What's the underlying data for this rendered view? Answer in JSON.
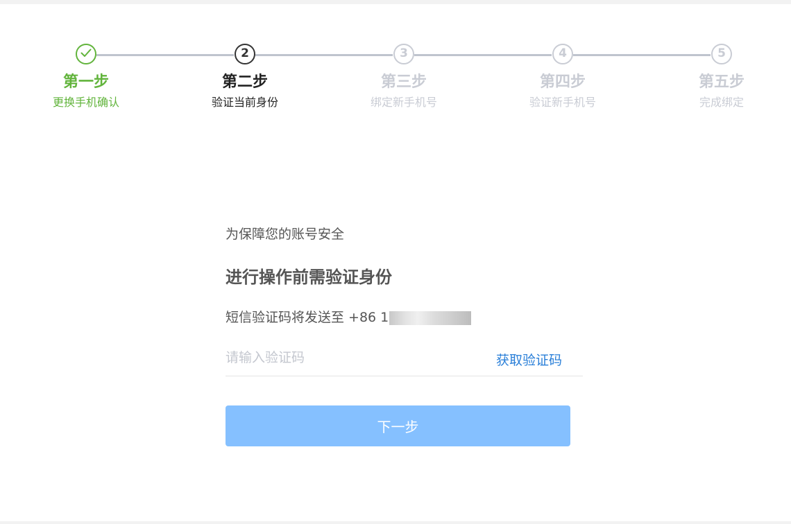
{
  "steps": [
    {
      "status": "done",
      "number": "",
      "icon": "check-icon",
      "title": "第一步",
      "subtitle": "更换手机确认"
    },
    {
      "status": "active",
      "number": "2",
      "title": "第二步",
      "subtitle": "验证当前身份"
    },
    {
      "status": "pending",
      "number": "3",
      "title": "第三步",
      "subtitle": "绑定新手机号"
    },
    {
      "status": "pending",
      "number": "4",
      "title": "第四步",
      "subtitle": "验证新手机号"
    },
    {
      "status": "pending",
      "number": "5",
      "title": "第五步",
      "subtitle": "完成绑定"
    }
  ],
  "form": {
    "notice": "为保障您的账号安全",
    "heading": "进行操作前需验证身份",
    "sms_prefix": "短信验证码将发送至 +86 1",
    "code_placeholder": "请输入验证码",
    "code_value": "",
    "get_code_label": "获取验证码",
    "next_label": "下一步"
  },
  "colors": {
    "done": "#62b43c",
    "active": "#333333",
    "pending": "#c9ccd4",
    "link": "#2a7fd8",
    "button": "#85c0ff"
  }
}
